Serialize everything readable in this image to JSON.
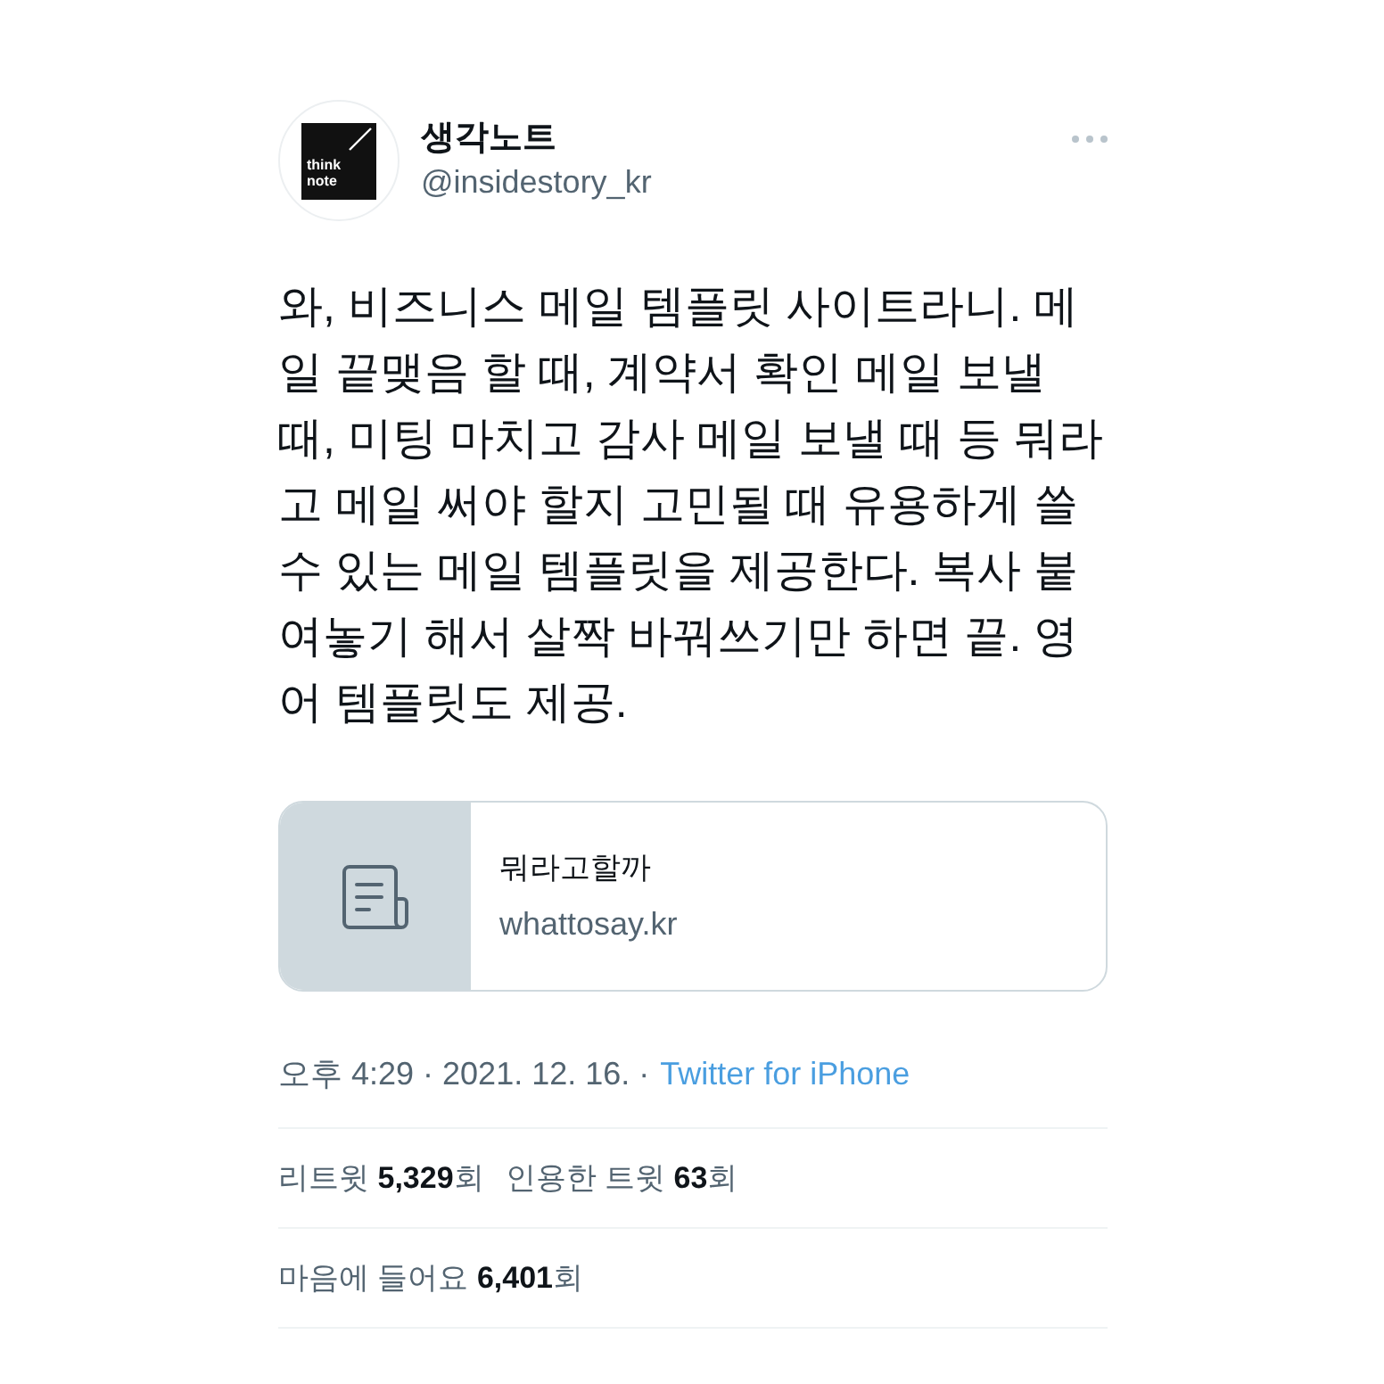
{
  "author": {
    "name": "생각노트",
    "handle": "@insidestory_kr",
    "logo_text": [
      "think",
      "note"
    ]
  },
  "tweet": {
    "text": "와, 비즈니스 메일 템플릿 사이트라니. 메일 끝맺음 할 때, 계약서 확인 메일 보낼 때, 미팅 마치고 감사 메일 보낼 때 등 뭐라고 메일 써야 할지 고민될 때 유용하게 쓸 수 있는 메일 템플릿을 제공한다. 복사 붙여놓기 해서 살짝 바꿔쓰기만 하면 끝. 영어 템플릿도 제공."
  },
  "link_card": {
    "title": "뭐라고할까",
    "domain": "whattosay.kr"
  },
  "meta": {
    "timestamp": "오후 4:29 · 2021. 12. 16. ·",
    "source": "Twitter for iPhone"
  },
  "stats": [
    {
      "items": [
        "리트윗 **5,329**회",
        "인용한 트윗 **63**회"
      ]
    },
    {
      "items": [
        "마음에 들어요 **6,401**회"
      ]
    }
  ]
}
